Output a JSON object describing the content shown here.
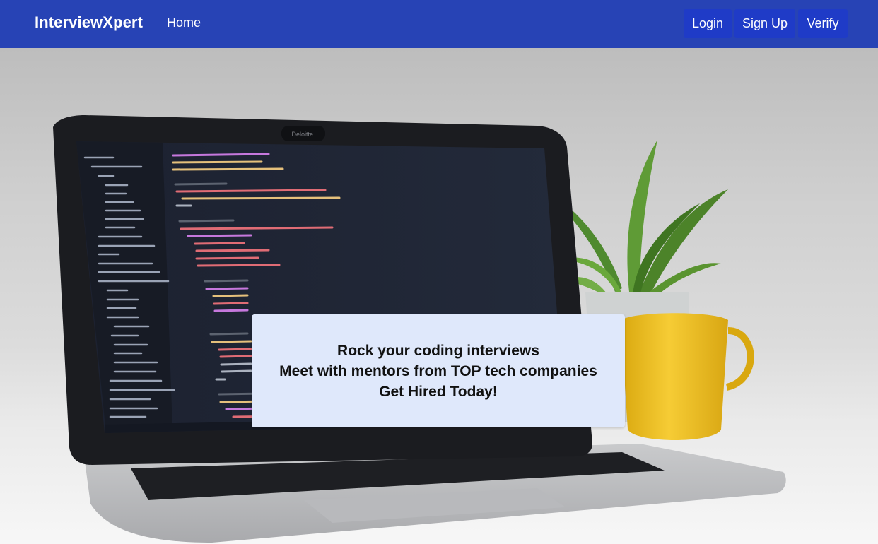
{
  "navbar": {
    "brand": "InterviewXpert",
    "home": "Home",
    "login": "Login",
    "signup": "Sign Up",
    "verify": "Verify",
    "color": "#2743b5"
  },
  "hero": {
    "image": "laptop-with-code-on-desk-beside-plant",
    "bezel_label": "Deloitte.",
    "card": {
      "line1": "Rock your coding interviews",
      "line2": "Meet with mentors from TOP tech companies",
      "line3": "Get Hired Today!"
    }
  }
}
